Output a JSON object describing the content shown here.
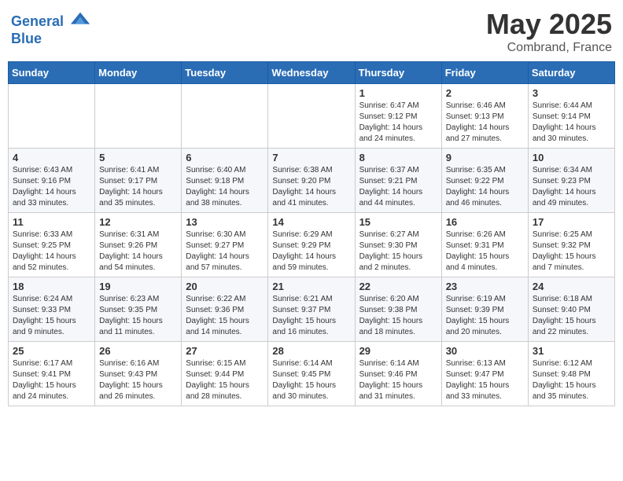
{
  "header": {
    "logo_line1": "General",
    "logo_line2": "Blue",
    "month": "May 2025",
    "location": "Combrand, France"
  },
  "weekdays": [
    "Sunday",
    "Monday",
    "Tuesday",
    "Wednesday",
    "Thursday",
    "Friday",
    "Saturday"
  ],
  "weeks": [
    [
      {
        "day": "",
        "info": ""
      },
      {
        "day": "",
        "info": ""
      },
      {
        "day": "",
        "info": ""
      },
      {
        "day": "",
        "info": ""
      },
      {
        "day": "1",
        "info": "Sunrise: 6:47 AM\nSunset: 9:12 PM\nDaylight: 14 hours\nand 24 minutes."
      },
      {
        "day": "2",
        "info": "Sunrise: 6:46 AM\nSunset: 9:13 PM\nDaylight: 14 hours\nand 27 minutes."
      },
      {
        "day": "3",
        "info": "Sunrise: 6:44 AM\nSunset: 9:14 PM\nDaylight: 14 hours\nand 30 minutes."
      }
    ],
    [
      {
        "day": "4",
        "info": "Sunrise: 6:43 AM\nSunset: 9:16 PM\nDaylight: 14 hours\nand 33 minutes."
      },
      {
        "day": "5",
        "info": "Sunrise: 6:41 AM\nSunset: 9:17 PM\nDaylight: 14 hours\nand 35 minutes."
      },
      {
        "day": "6",
        "info": "Sunrise: 6:40 AM\nSunset: 9:18 PM\nDaylight: 14 hours\nand 38 minutes."
      },
      {
        "day": "7",
        "info": "Sunrise: 6:38 AM\nSunset: 9:20 PM\nDaylight: 14 hours\nand 41 minutes."
      },
      {
        "day": "8",
        "info": "Sunrise: 6:37 AM\nSunset: 9:21 PM\nDaylight: 14 hours\nand 44 minutes."
      },
      {
        "day": "9",
        "info": "Sunrise: 6:35 AM\nSunset: 9:22 PM\nDaylight: 14 hours\nand 46 minutes."
      },
      {
        "day": "10",
        "info": "Sunrise: 6:34 AM\nSunset: 9:23 PM\nDaylight: 14 hours\nand 49 minutes."
      }
    ],
    [
      {
        "day": "11",
        "info": "Sunrise: 6:33 AM\nSunset: 9:25 PM\nDaylight: 14 hours\nand 52 minutes."
      },
      {
        "day": "12",
        "info": "Sunrise: 6:31 AM\nSunset: 9:26 PM\nDaylight: 14 hours\nand 54 minutes."
      },
      {
        "day": "13",
        "info": "Sunrise: 6:30 AM\nSunset: 9:27 PM\nDaylight: 14 hours\nand 57 minutes."
      },
      {
        "day": "14",
        "info": "Sunrise: 6:29 AM\nSunset: 9:29 PM\nDaylight: 14 hours\nand 59 minutes."
      },
      {
        "day": "15",
        "info": "Sunrise: 6:27 AM\nSunset: 9:30 PM\nDaylight: 15 hours\nand 2 minutes."
      },
      {
        "day": "16",
        "info": "Sunrise: 6:26 AM\nSunset: 9:31 PM\nDaylight: 15 hours\nand 4 minutes."
      },
      {
        "day": "17",
        "info": "Sunrise: 6:25 AM\nSunset: 9:32 PM\nDaylight: 15 hours\nand 7 minutes."
      }
    ],
    [
      {
        "day": "18",
        "info": "Sunrise: 6:24 AM\nSunset: 9:33 PM\nDaylight: 15 hours\nand 9 minutes."
      },
      {
        "day": "19",
        "info": "Sunrise: 6:23 AM\nSunset: 9:35 PM\nDaylight: 15 hours\nand 11 minutes."
      },
      {
        "day": "20",
        "info": "Sunrise: 6:22 AM\nSunset: 9:36 PM\nDaylight: 15 hours\nand 14 minutes."
      },
      {
        "day": "21",
        "info": "Sunrise: 6:21 AM\nSunset: 9:37 PM\nDaylight: 15 hours\nand 16 minutes."
      },
      {
        "day": "22",
        "info": "Sunrise: 6:20 AM\nSunset: 9:38 PM\nDaylight: 15 hours\nand 18 minutes."
      },
      {
        "day": "23",
        "info": "Sunrise: 6:19 AM\nSunset: 9:39 PM\nDaylight: 15 hours\nand 20 minutes."
      },
      {
        "day": "24",
        "info": "Sunrise: 6:18 AM\nSunset: 9:40 PM\nDaylight: 15 hours\nand 22 minutes."
      }
    ],
    [
      {
        "day": "25",
        "info": "Sunrise: 6:17 AM\nSunset: 9:41 PM\nDaylight: 15 hours\nand 24 minutes."
      },
      {
        "day": "26",
        "info": "Sunrise: 6:16 AM\nSunset: 9:43 PM\nDaylight: 15 hours\nand 26 minutes."
      },
      {
        "day": "27",
        "info": "Sunrise: 6:15 AM\nSunset: 9:44 PM\nDaylight: 15 hours\nand 28 minutes."
      },
      {
        "day": "28",
        "info": "Sunrise: 6:14 AM\nSunset: 9:45 PM\nDaylight: 15 hours\nand 30 minutes."
      },
      {
        "day": "29",
        "info": "Sunrise: 6:14 AM\nSunset: 9:46 PM\nDaylight: 15 hours\nand 31 minutes."
      },
      {
        "day": "30",
        "info": "Sunrise: 6:13 AM\nSunset: 9:47 PM\nDaylight: 15 hours\nand 33 minutes."
      },
      {
        "day": "31",
        "info": "Sunrise: 6:12 AM\nSunset: 9:48 PM\nDaylight: 15 hours\nand 35 minutes."
      }
    ]
  ]
}
